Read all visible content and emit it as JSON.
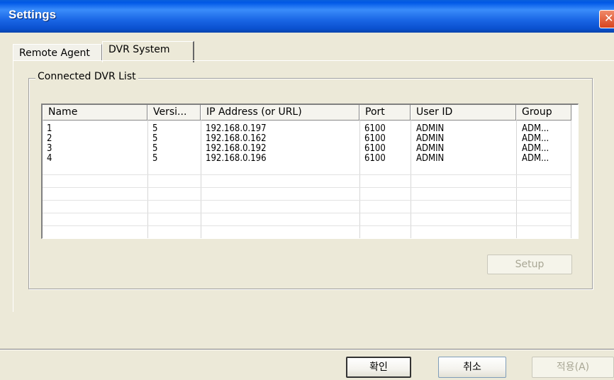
{
  "window": {
    "title": "Settings",
    "close_glyph": "✕"
  },
  "tabs": [
    {
      "label": "Remote Agent"
    },
    {
      "label": "DVR System"
    }
  ],
  "group": {
    "legend": "Connected DVR List"
  },
  "list": {
    "columns": [
      "Name",
      "Versi...",
      "IP Address (or URL)",
      "Port",
      "User ID",
      "Group"
    ],
    "rows": [
      [
        "1",
        "5",
        "192.168.0.197",
        "6100",
        "ADMIN",
        "ADM..."
      ],
      [
        "2",
        "5",
        "192.168.0.162",
        "6100",
        "ADMIN",
        "ADM..."
      ],
      [
        "3",
        "5",
        "192.168.0.192",
        "6100",
        "ADMIN",
        "ADM..."
      ],
      [
        "4",
        "5",
        "192.168.0.196",
        "6100",
        "ADMIN",
        "ADM..."
      ]
    ]
  },
  "buttons": {
    "setup": "Setup",
    "ok": "확인",
    "cancel": "취소",
    "apply": "적용(A)"
  },
  "colors": {
    "titlebar": "#0058e6",
    "dialog": "#ece9d8",
    "close": "#d8431e"
  },
  "icons": {
    "close": "close-icon"
  }
}
